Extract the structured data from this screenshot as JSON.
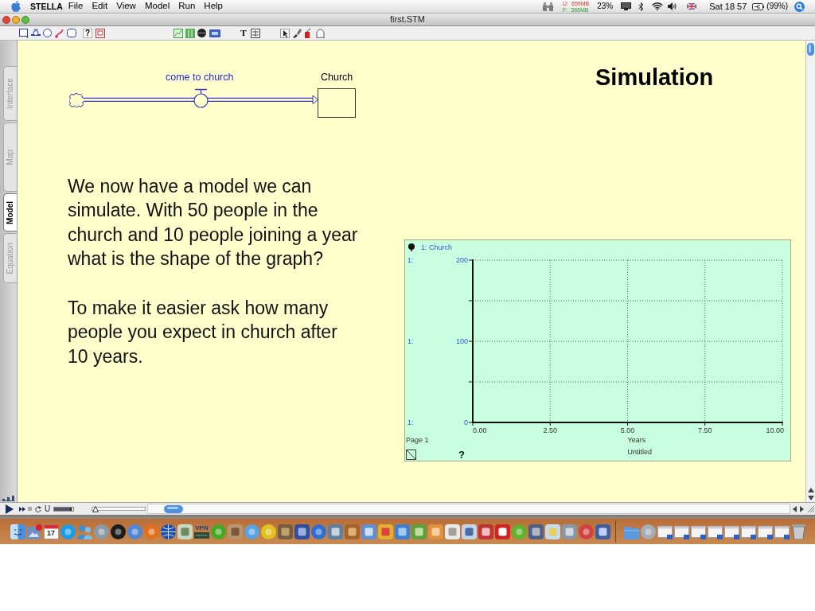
{
  "menu_bar": {
    "app_name": "STELLA",
    "menus": [
      "File",
      "Edit",
      "View",
      "Model",
      "Run",
      "Help"
    ],
    "memory": [
      {
        "label": "U:",
        "value": "659MB",
        "kind": "used"
      },
      {
        "label": "F:",
        "value": "365MB",
        "kind": "free"
      }
    ],
    "cpu": "23%",
    "clock": "Sat 18 57",
    "battery": "(99%)"
  },
  "window": {
    "title": "first.STM"
  },
  "toolbar": {
    "help_tool": "?",
    "text_tool": "T"
  },
  "side_tabs": [
    {
      "label": "Interface",
      "selected": false
    },
    {
      "label": "Map",
      "selected": false
    },
    {
      "label": "Model",
      "selected": true
    },
    {
      "label": "Equation",
      "selected": false
    }
  ],
  "model_diagram": {
    "flow": {
      "label": "come to church"
    },
    "stock": {
      "label": "Church"
    }
  },
  "slide": {
    "heading": "Simulation",
    "paragraphs": [
      "We now have a model we can simulate. With 50 people in the church and 10 people joining a year what is the shape of the graph?",
      "To make it easier ask how many people you expect in church after 10 years."
    ]
  },
  "graph": {
    "legend_label": "1: Church",
    "scale_labels": [
      "1:",
      "1:",
      "1:"
    ],
    "page_label": "Page 1",
    "help_button": "?",
    "chart_data": {
      "type": "line",
      "title": "Untitled",
      "xlabel": "Years",
      "categories": [
        "0.00",
        "2.50",
        "5.00",
        "7.50",
        "10.00"
      ],
      "ylim": [
        0,
        200
      ],
      "yticks": [
        0,
        100,
        200
      ],
      "grid": true
    }
  },
  "run_controls": {
    "u_button": "U",
    "sliders": [
      {
        "level": 0.9
      },
      {
        "level": 0.06
      }
    ]
  },
  "dock": {
    "calendar_day": "17",
    "vpn_label": "VPN"
  }
}
